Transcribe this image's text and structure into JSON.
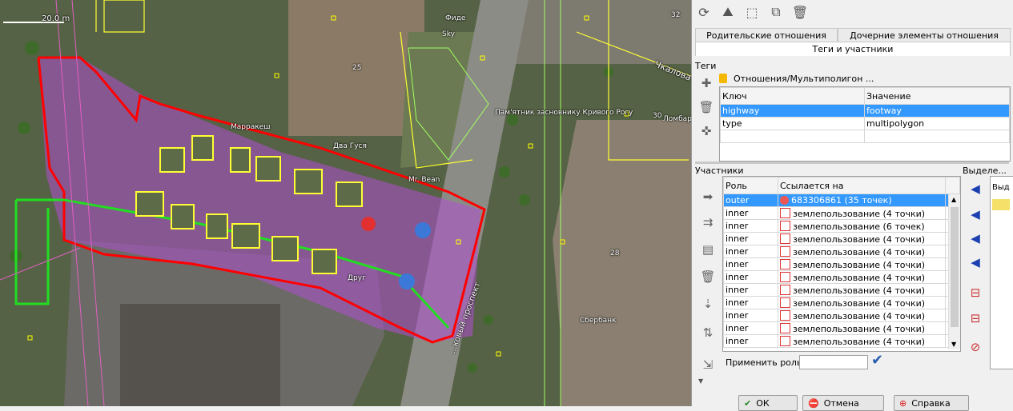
{
  "map": {
    "scale": "20.0 m",
    "labels": {
      "fide": "Фиде",
      "sky": "Sky",
      "num25": "25",
      "num32": "32",
      "marrakesh": "Марракеш",
      "dva_gusya": "Два Гуся",
      "monument": "Пам'ятник засновнику Кривого Рогу",
      "mr_bean": "Mr. Bean",
      "drug": "Друг",
      "sberbank": "Сбербанк",
      "chkalova": "Чкалова у",
      "lombard": "Ломбард",
      "num30": "30",
      "num28": "28",
      "prospect": "...ковый проспект"
    }
  },
  "panel": {
    "tabs": {
      "parent": "Родительские отношения",
      "children": "Дочерние элементы отношения",
      "tags_members": "Теги и участники"
    },
    "tags": {
      "section": "Теги",
      "relation_title": "Отношения/Мультиполигон ...",
      "header_key": "Ключ",
      "header_value": "Значение",
      "rows": [
        {
          "key": "highway",
          "value": "footway"
        },
        {
          "key": "type",
          "value": "multipolygon"
        }
      ]
    },
    "members": {
      "section": "Участники",
      "header_role": "Роль",
      "header_ref": "Ссылается на",
      "rows": [
        {
          "role": "outer",
          "ref": "683306861 (35 точек)"
        },
        {
          "role": "inner",
          "ref": "землепользование (4 точки)"
        },
        {
          "role": "inner",
          "ref": "землепользование (6 точек)"
        },
        {
          "role": "inner",
          "ref": "землепользование (4 точки)"
        },
        {
          "role": "inner",
          "ref": "землепользование (4 точки)"
        },
        {
          "role": "inner",
          "ref": "землепользование (4 точки)"
        },
        {
          "role": "inner",
          "ref": "землепользование (4 точки)"
        },
        {
          "role": "inner",
          "ref": "землепользование (4 точки)"
        },
        {
          "role": "inner",
          "ref": "землепользование (4 точки)"
        },
        {
          "role": "inner",
          "ref": "землепользование (4 точки)"
        },
        {
          "role": "inner",
          "ref": "землепользование (4 точки)"
        },
        {
          "role": "inner",
          "ref": "землепользование (4 точки)"
        }
      ],
      "apply_role": "Применить роль:",
      "apply_value": ""
    },
    "selection": {
      "section": "Выделе...",
      "row": "Выд"
    },
    "buttons": {
      "ok": "ОК",
      "cancel": "Отмена",
      "help": "Справка"
    },
    "colors": {
      "selected_row": "#3399ff",
      "relation_red": "#ff0000",
      "way_green": "#22dd22"
    }
  }
}
